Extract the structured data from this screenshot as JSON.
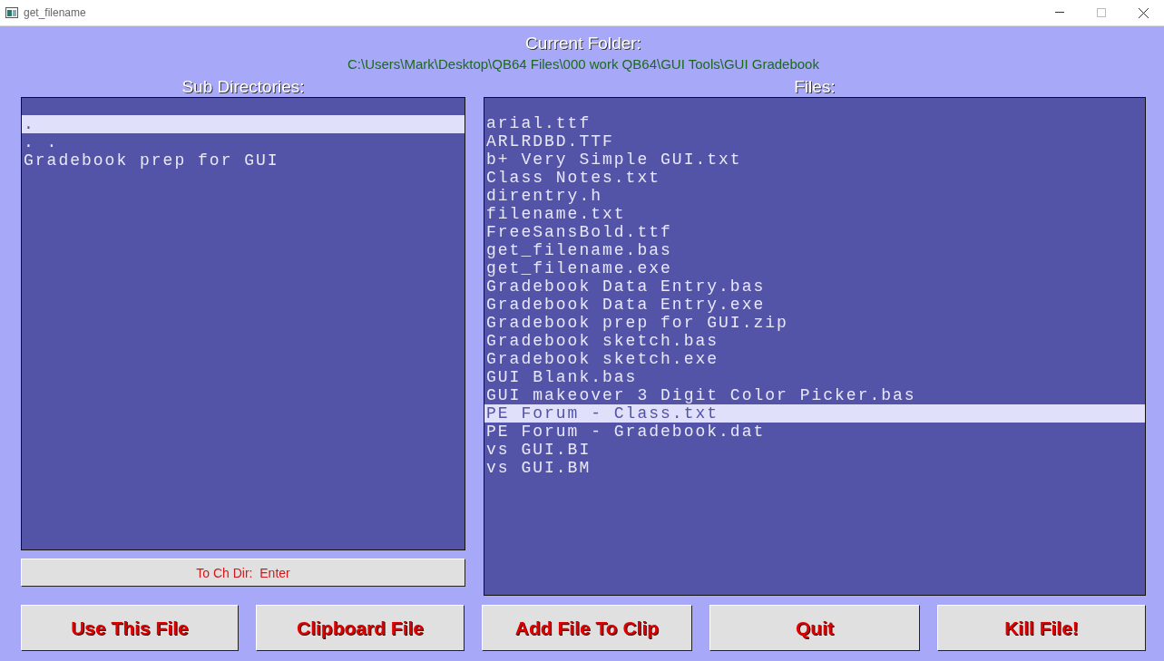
{
  "window": {
    "title": "get_filename"
  },
  "current_folder": {
    "label": "Current Folder:",
    "path": "C:\\Users\\Mark\\Desktop\\QB64 Files\\000 work QB64\\GUI Tools\\GUI Gradebook"
  },
  "sub_directories": {
    "label": "Sub Directories:",
    "items": [
      {
        "name": ".",
        "selected": true
      },
      {
        "name": ". .",
        "selected": false
      },
      {
        "name": "Gradebook prep for GUI",
        "selected": false
      }
    ],
    "hint": "To Ch Dir:  Enter"
  },
  "files": {
    "label": "Files:",
    "items": [
      {
        "name": "arial.ttf",
        "selected": false
      },
      {
        "name": "ARLRDBD.TTF",
        "selected": false
      },
      {
        "name": "b+ Very Simple GUI.txt",
        "selected": false
      },
      {
        "name": "Class Notes.txt",
        "selected": false
      },
      {
        "name": "direntry.h",
        "selected": false
      },
      {
        "name": "filename.txt",
        "selected": false
      },
      {
        "name": "FreeSansBold.ttf",
        "selected": false
      },
      {
        "name": "get_filename.bas",
        "selected": false
      },
      {
        "name": "get_filename.exe",
        "selected": false
      },
      {
        "name": "Gradebook Data Entry.bas",
        "selected": false
      },
      {
        "name": "Gradebook Data Entry.exe",
        "selected": false
      },
      {
        "name": "Gradebook prep for GUI.zip",
        "selected": false
      },
      {
        "name": "Gradebook sketch.bas",
        "selected": false
      },
      {
        "name": "Gradebook sketch.exe",
        "selected": false
      },
      {
        "name": "GUI Blank.bas",
        "selected": false
      },
      {
        "name": "GUI makeover 3 Digit Color Picker.bas",
        "selected": false
      },
      {
        "name": "PE Forum - Class.txt",
        "selected": true
      },
      {
        "name": "PE Forum - Gradebook.dat",
        "selected": false
      },
      {
        "name": "vs GUI.BI",
        "selected": false
      },
      {
        "name": "vs GUI.BM",
        "selected": false
      }
    ]
  },
  "buttons": [
    "Use This File",
    "Clipboard File",
    "Add File To Clip",
    "Quit",
    "Kill File!"
  ]
}
